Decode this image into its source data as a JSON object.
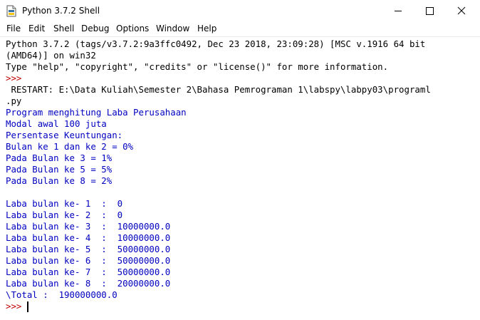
{
  "window": {
    "title": "Python 3.7.2 Shell"
  },
  "menu": {
    "items": [
      "File",
      "Edit",
      "Shell",
      "Debug",
      "Options",
      "Window",
      "Help"
    ]
  },
  "shell": {
    "banner": [
      "Python 3.7.2 (tags/v3.7.2:9a3ffc0492, Dec 23 2018, 23:09:28) [MSC v.1916 64 bit",
      "(AMD64)] on win32",
      "Type \"help\", \"copyright\", \"credits\" or \"license()\" for more information."
    ],
    "prompt": ">>>",
    "restart": [
      " RESTART: E:\\Data Kuliah\\Semester 2\\Bahasa Pemrograman 1\\labspy\\labpy03\\programl",
      ".py"
    ],
    "output": [
      "Program menghitung Laba Perusahaan",
      "Modal awal 100 juta",
      "Persentase Keuntungan:",
      "Bulan ke 1 dan ke 2 = 0%",
      "Pada Bulan ke 3 = 1%",
      "Pada Bulan ke 5 = 5%",
      "Pada Bulan ke 8 = 2%",
      "",
      "Laba bulan ke- 1  :  0",
      "Laba bulan ke- 2  :  0",
      "Laba bulan ke- 3  :  10000000.0",
      "Laba bulan ke- 4  :  10000000.0",
      "Laba bulan ke- 5  :  50000000.0",
      "Laba bulan ke- 6  :  50000000.0",
      "Laba bulan ke- 7  :  50000000.0",
      "Laba bulan ke- 8  :  20000000.0",
      "\\Total :  190000000.0"
    ],
    "final_prompt": ">>>"
  }
}
